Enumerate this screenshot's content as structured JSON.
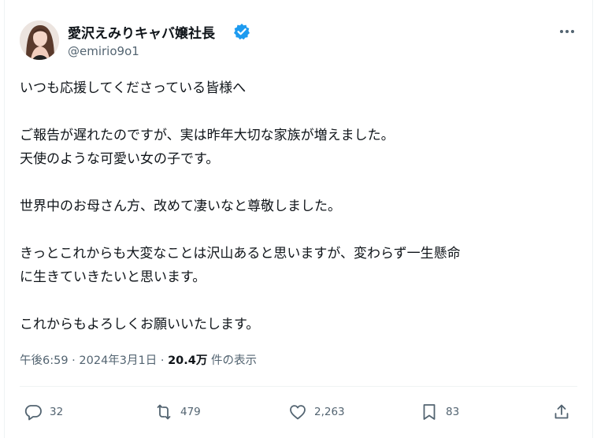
{
  "author": {
    "name": "愛沢えみりキャバ嬢社長",
    "handle": "@emirio9o1"
  },
  "tweet": {
    "lines": [
      "いつも応援してくださっている皆様へ",
      "",
      "ご報告が遅れたのですが、実は昨年大切な家族が増えました。",
      "天使のような可愛い女の子です。",
      "",
      "世界中のお母さん方、改めて凄いなと尊敬しました。",
      "",
      "きっとこれからも大変なことは沢山あると思いますが、変わらず一生懸命",
      "に生きていきたいと思います。",
      "",
      "これからもよろしくお願いいたします。"
    ]
  },
  "meta": {
    "time": "午後6:59",
    "sep1": " · ",
    "date": "2024年3月1日",
    "sep2": " · ",
    "views": "20.4万",
    "views_label": " 件の表示"
  },
  "actions": {
    "replies": "32",
    "reposts": "479",
    "likes": "2,263",
    "bookmarks": "83"
  },
  "colors": {
    "verified": "#1d9bf0",
    "text": "#0f1419",
    "muted": "#536471"
  }
}
